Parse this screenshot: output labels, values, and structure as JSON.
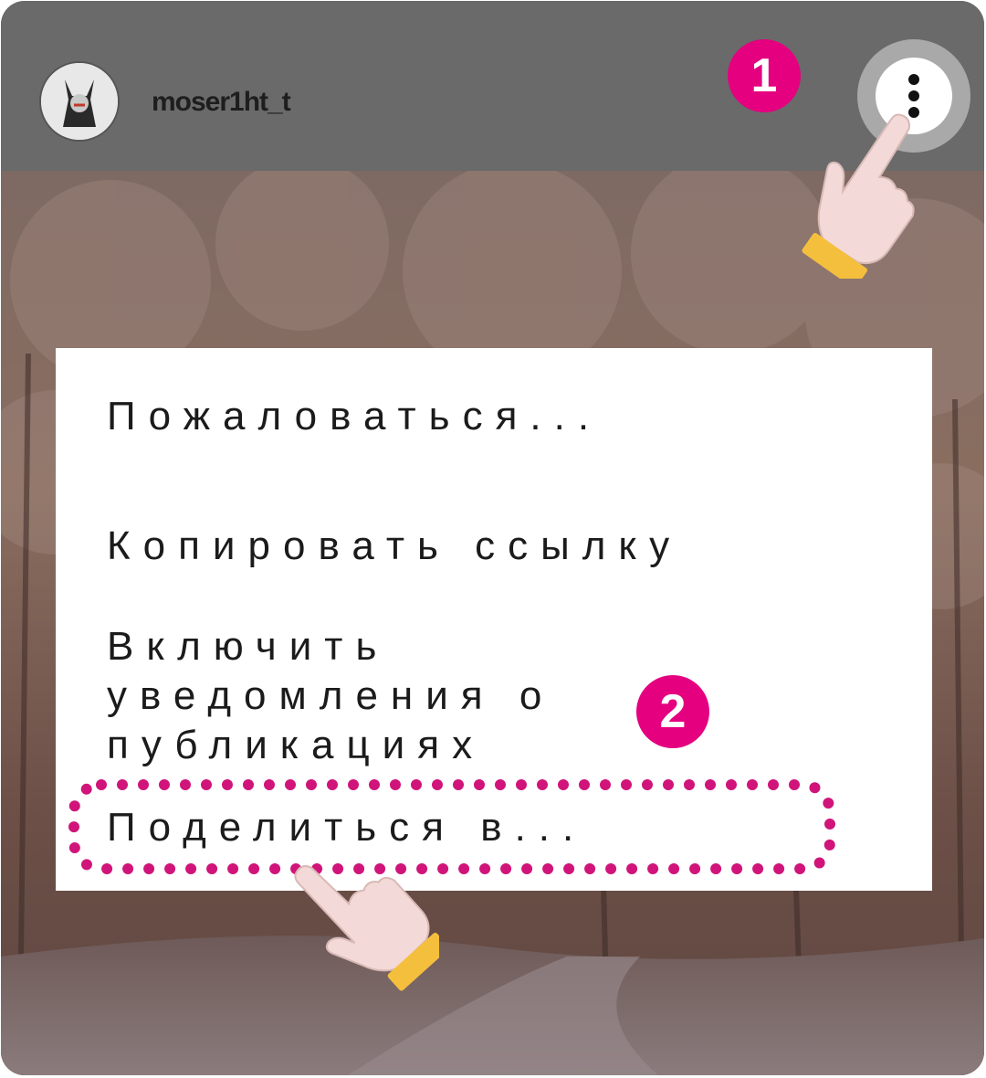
{
  "post": {
    "username": "moser1ht_t"
  },
  "steps": {
    "step1": "1",
    "step2": "2"
  },
  "menu": {
    "items": [
      {
        "label": "Пожаловаться..."
      },
      {
        "label": "Копировать ссылку"
      },
      {
        "label_lines": [
          "Включить",
          "уведомления о",
          "публикациях"
        ]
      },
      {
        "label": "Поделиться в..."
      }
    ]
  },
  "colors": {
    "accent": "#e4007f",
    "header": "#6a6a6a",
    "menu_bg": "#ffffff",
    "cuff": "#f5bf3e",
    "hand": "#f3d9d7"
  },
  "icons": {
    "more": "more-vertical-icon",
    "pointer": "pointing-hand-icon"
  }
}
